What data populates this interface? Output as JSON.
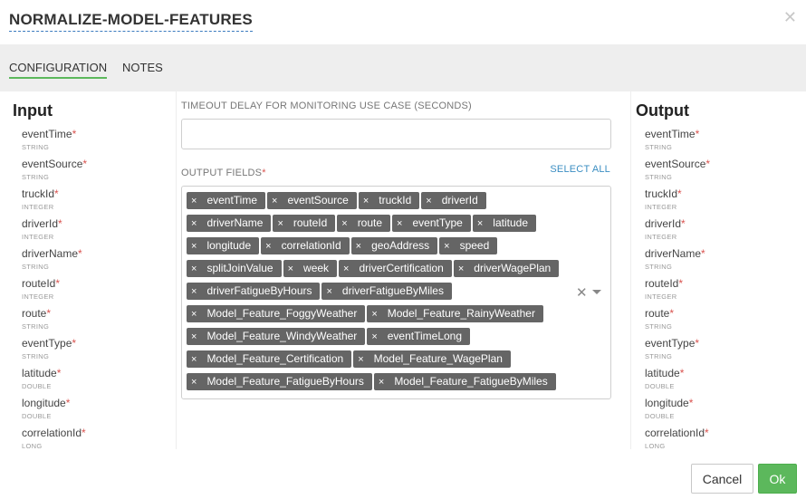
{
  "header": {
    "title": "NORMALIZE-MODEL-FEATURES",
    "close_glyph": "✕"
  },
  "tabs": [
    {
      "label": "CONFIGURATION",
      "active": true
    },
    {
      "label": "NOTES",
      "active": false
    }
  ],
  "input_panel": {
    "title": "Input",
    "fields": [
      {
        "name": "eventTime",
        "required": "*",
        "type": "STRING"
      },
      {
        "name": "eventSource",
        "required": "*",
        "type": "STRING"
      },
      {
        "name": "truckId",
        "required": "*",
        "type": "INTEGER"
      },
      {
        "name": "driverId",
        "required": "*",
        "type": "INTEGER"
      },
      {
        "name": "driverName",
        "required": "*",
        "type": "STRING"
      },
      {
        "name": "routeId",
        "required": "*",
        "type": "INTEGER"
      },
      {
        "name": "route",
        "required": "*",
        "type": "STRING"
      },
      {
        "name": "eventType",
        "required": "*",
        "type": "STRING"
      },
      {
        "name": "latitude",
        "required": "*",
        "type": "DOUBLE"
      },
      {
        "name": "longitude",
        "required": "*",
        "type": "DOUBLE"
      },
      {
        "name": "correlationId",
        "required": "*",
        "type": "LONG"
      }
    ]
  },
  "output_panel": {
    "title": "Output",
    "fields": [
      {
        "name": "eventTime",
        "required": "*",
        "type": "STRING"
      },
      {
        "name": "eventSource",
        "required": "*",
        "type": "STRING"
      },
      {
        "name": "truckId",
        "required": "*",
        "type": "INTEGER"
      },
      {
        "name": "driverId",
        "required": "*",
        "type": "INTEGER"
      },
      {
        "name": "driverName",
        "required": "*",
        "type": "STRING"
      },
      {
        "name": "routeId",
        "required": "*",
        "type": "INTEGER"
      },
      {
        "name": "route",
        "required": "*",
        "type": "STRING"
      },
      {
        "name": "eventType",
        "required": "*",
        "type": "STRING"
      },
      {
        "name": "latitude",
        "required": "*",
        "type": "DOUBLE"
      },
      {
        "name": "longitude",
        "required": "*",
        "type": "DOUBLE"
      },
      {
        "name": "correlationId",
        "required": "*",
        "type": "LONG"
      }
    ]
  },
  "config": {
    "timeout_label": "TIMEOUT DELAY FOR MONITORING USE CASE (SECONDS)",
    "timeout_value": "",
    "output_fields_label": "OUTPUT FIELDS",
    "output_fields_required": "*",
    "select_all": "SELECT ALL",
    "clear_glyph": "✕",
    "tag_remove_glyph": "×",
    "tags": [
      "eventTime",
      "eventSource",
      "truckId",
      "driverId",
      "driverName",
      "routeId",
      "route",
      "eventType",
      "latitude",
      "longitude",
      "correlationId",
      "geoAddress",
      "speed",
      "splitJoinValue",
      "week",
      "driverCertification",
      "driverWagePlan",
      "driverFatigueByHours",
      "driverFatigueByMiles",
      "Model_Feature_FoggyWeather",
      "Model_Feature_RainyWeather",
      "Model_Feature_WindyWeather",
      "eventTimeLong",
      "Model_Feature_Certification",
      "Model_Feature_WagePlan",
      "Model_Feature_FatigueByHours",
      "Model_Feature_FatigueByMiles"
    ]
  },
  "footer": {
    "cancel_label": "Cancel",
    "ok_label": "Ok"
  },
  "colors": {
    "accent_green": "#5cb85c",
    "link_blue": "#3b8ec2",
    "tag_bg": "#656565",
    "required_red": "#d9534f"
  }
}
